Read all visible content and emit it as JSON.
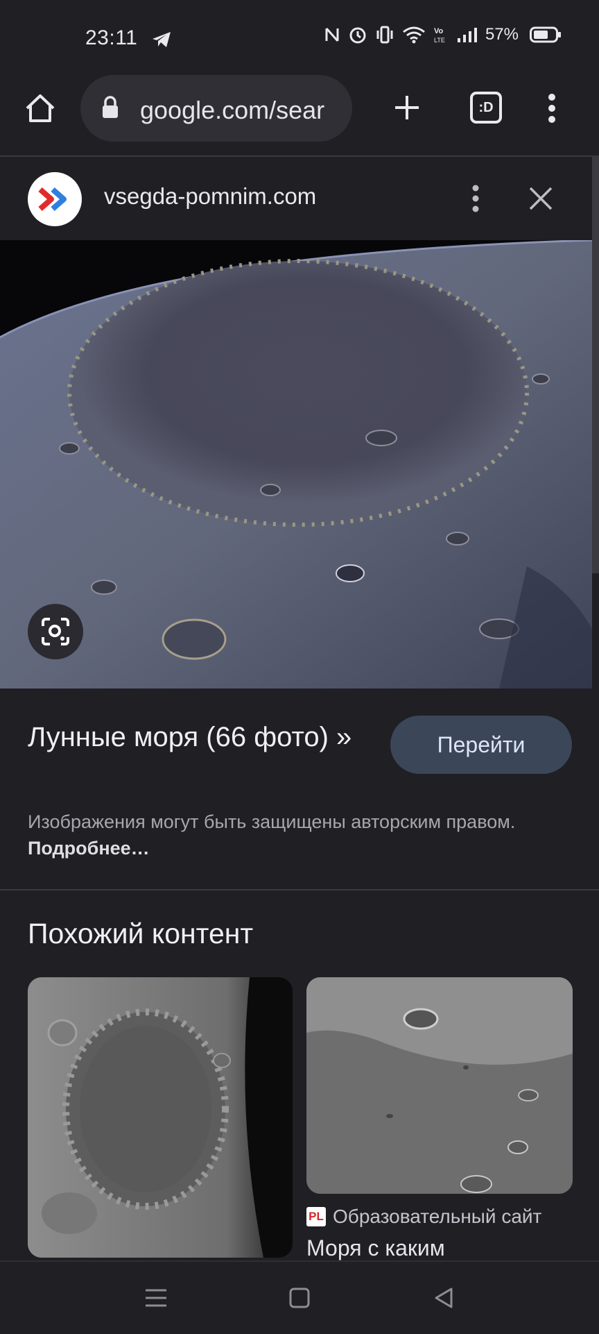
{
  "status_bar": {
    "time": "23:11",
    "battery": "57%",
    "icons": [
      "telegram-icon",
      "nfc-icon",
      "alarm-icon",
      "vibrate-icon",
      "wifi-icon",
      "volte-icon",
      "signal-icon",
      "battery-icon"
    ]
  },
  "browser": {
    "url": "google.com/sear",
    "tab_switcher_label": ":D"
  },
  "sheet": {
    "domain": "vsegda-pomnim.com",
    "title": "Лунные моря (66 фото) »",
    "go_button": "Перейти",
    "copyright_text": "Изображения могут быть защищены авторским правом.",
    "copyright_link": "Подробнее…"
  },
  "similar": {
    "heading": "Похожий контент",
    "right_card": {
      "source_badge": "PL",
      "source_name": "Образовательный сайт",
      "title": "Моря с каким"
    }
  }
}
